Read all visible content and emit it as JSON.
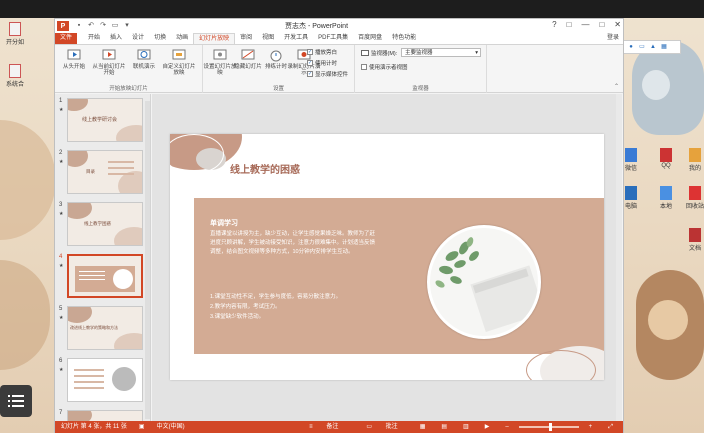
{
  "desktop": {
    "left_icons": [
      {
        "label": "开分如"
      },
      {
        "label": "系统合"
      }
    ],
    "right_icons": [
      {
        "label": "微信"
      },
      {
        "label": "QQ"
      },
      {
        "label": "我的"
      },
      {
        "label": "电脑"
      },
      {
        "label": "本地"
      },
      {
        "label": "回收站"
      },
      {
        "label": "文档"
      },
      {
        "label": "工具"
      }
    ]
  },
  "window": {
    "title": "贾志杰 - PowerPoint",
    "app_icon": "P",
    "controls": {
      "help": "?",
      "ribbon_opts": "□",
      "minimize": "—",
      "maximize": "□",
      "close": "✕"
    },
    "login": "登录"
  },
  "tabs": [
    {
      "label": "文件"
    },
    {
      "label": "开始"
    },
    {
      "label": "插入"
    },
    {
      "label": "设计"
    },
    {
      "label": "切换"
    },
    {
      "label": "动画"
    },
    {
      "label": "幻灯片放映"
    },
    {
      "label": "审阅"
    },
    {
      "label": "视图"
    },
    {
      "label": "开发工具"
    },
    {
      "label": "PDF工具集"
    },
    {
      "label": "百度网盘"
    },
    {
      "label": "特色功能"
    }
  ],
  "ribbon": {
    "group1": {
      "label": "开始放映幻灯片",
      "buttons": [
        "从头开始",
        "从当前幻灯片开始",
        "联机演示",
        "自定义幻灯片放映"
      ]
    },
    "group2": {
      "label": "设置",
      "buttons": [
        "设置幻灯片放映",
        "隐藏幻灯片",
        "排练计时",
        "录制幻灯片演示"
      ],
      "checks": [
        "播放旁白",
        "使用计时",
        "显示媒体控件"
      ]
    },
    "group3": {
      "label": "监视器",
      "monitor_label": "监视器(M):",
      "monitor_value": "主要监视器",
      "presenter_check": "使用演示者视图"
    }
  },
  "thumbnails": [
    {
      "num": "1",
      "text": "线上教学研讨会"
    },
    {
      "num": "2",
      "text": "目录"
    },
    {
      "num": "3",
      "text": "线上教学困惑"
    },
    {
      "num": "4",
      "text": ""
    },
    {
      "num": "5",
      "text": "改进线上教学的策略和方法"
    },
    {
      "num": "6",
      "text": ""
    },
    {
      "num": "7",
      "text": ""
    }
  ],
  "slide": {
    "title": "线上教学的困惑",
    "heading": "单调学习",
    "body": "直播课堂以讲授为主，缺少互动，让学生感觉果燥乏味。教师为了赶进度只顾讲解，学生被动接受知识，注意力很难集中。计划适当反馈调整，结合图文视频等多种方式，10分钟内安排学生互动。",
    "list": [
      "1.课堂互动性不足，学生参与度低，容易分散注意力。",
      "2.教学内容有限，考试压力。",
      "3.课堂缺少软件活动。"
    ]
  },
  "status": {
    "slide_info": "幻灯片 第 4 张，共 11 张",
    "language": "中文(中国)",
    "notes": "备注",
    "comments": "批注",
    "zoom_minus": "–",
    "zoom_plus": "+",
    "zoom_level": 0.5
  },
  "ime": {
    "logo": "S",
    "lang": "英"
  },
  "colors": {
    "accent": "#d24726",
    "panel": "#d3ab94",
    "title": "#a76a58"
  }
}
